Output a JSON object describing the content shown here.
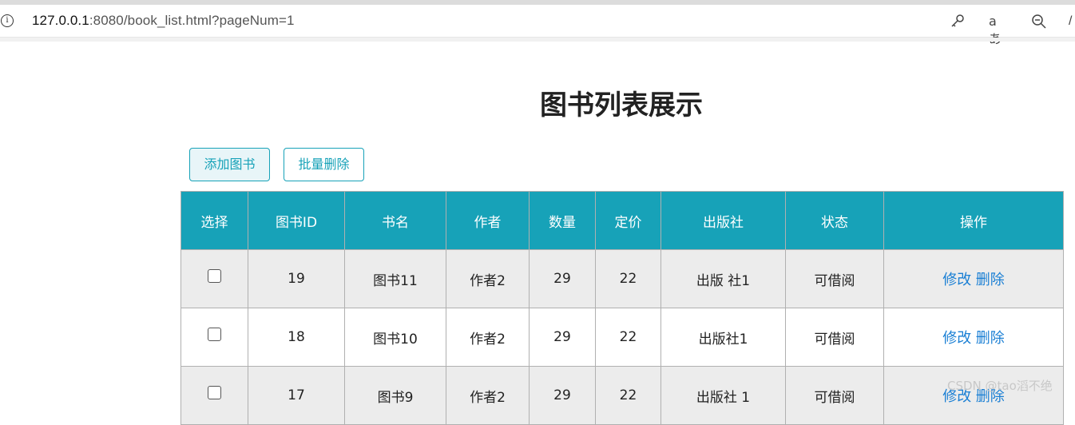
{
  "browser": {
    "url_host": "127.0.0.1",
    "url_rest": ":8080/book_list.html?pageNum=1",
    "info_icon": "i",
    "read_aloud_icon": "aあ",
    "more_icon": "/"
  },
  "page": {
    "title": "图书列表展示",
    "add_button": "添加图书",
    "batch_delete_button": "批量删除"
  },
  "table": {
    "columns": [
      "选择",
      "图书ID",
      "书名",
      "作者",
      "数量",
      "定价",
      "出版社",
      "状态",
      "操作"
    ],
    "rows": [
      {
        "id": "19",
        "name": "图书11",
        "author": "作者2",
        "count": "29",
        "price": "22",
        "publisher": "出版 社1",
        "status": "可借阅",
        "edit": "修改",
        "delete": "删除"
      },
      {
        "id": "18",
        "name": "图书10",
        "author": "作者2",
        "count": "29",
        "price": "22",
        "publisher": "出版社1",
        "status": "可借阅",
        "edit": "修改",
        "delete": "删除"
      },
      {
        "id": "17",
        "name": "图书9",
        "author": "作者2",
        "count": "29",
        "price": "22",
        "publisher": "出版社 1",
        "status": "可借阅",
        "edit": "修改",
        "delete": "删除"
      }
    ]
  },
  "watermark": "CSDN @tao滔不绝",
  "colors": {
    "accent": "#17a2b8",
    "link": "#1a7fd4",
    "row_alt": "#ececec"
  }
}
